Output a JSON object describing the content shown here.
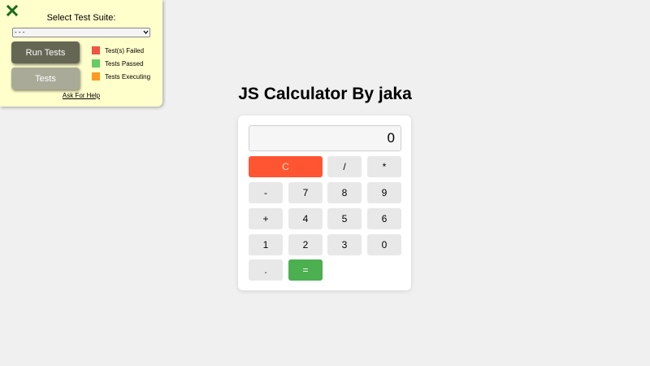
{
  "test_panel": {
    "title": "Select Test Suite:",
    "select_value": "- - -",
    "run_button": "Run Tests",
    "tests_button": "Tests",
    "legend": [
      {
        "label": "Test(s) Failed",
        "color": "#ee5544"
      },
      {
        "label": "Tests Passed",
        "color": "#66cc66"
      },
      {
        "label": "Tests Executing",
        "color": "#ff9922"
      }
    ],
    "help_link": "Ask For Help",
    "close_color": "#1a6b1a"
  },
  "calculator": {
    "title": "JS Calculator By jaka",
    "display": "0",
    "keys": {
      "clear": "C",
      "divide": "/",
      "multiply": "*",
      "minus": "-",
      "seven": "7",
      "eight": "8",
      "nine": "9",
      "plus": "+",
      "four": "4",
      "five": "5",
      "six": "6",
      "one": "1",
      "two": "2",
      "three": "3",
      "zero": "0",
      "decimal": ".",
      "equals": "="
    },
    "colors": {
      "clear": "#ff5533",
      "equals": "#4caf50"
    }
  }
}
